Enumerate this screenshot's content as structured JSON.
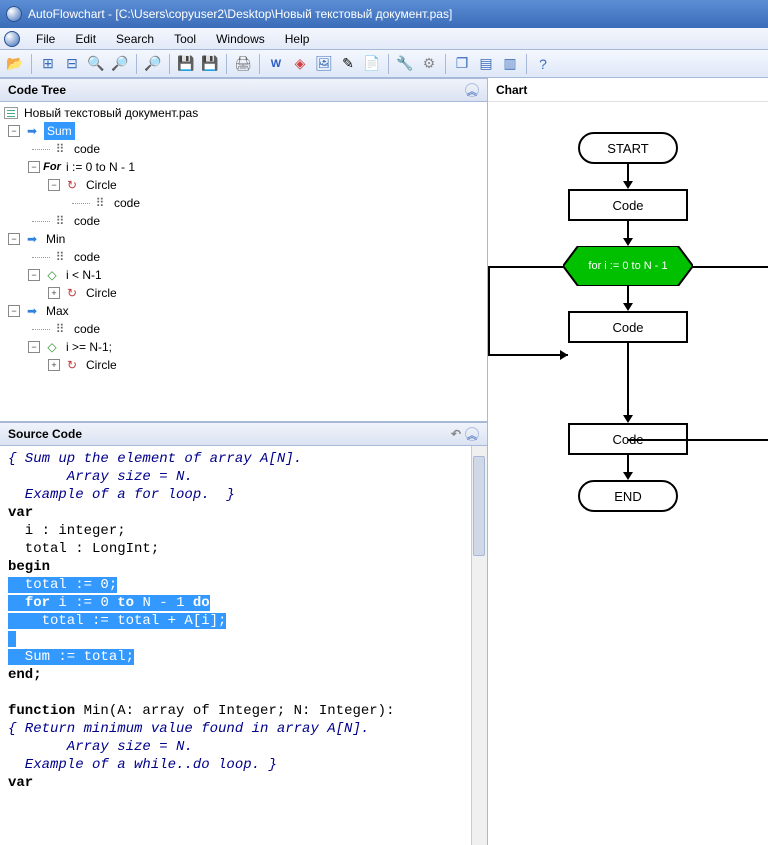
{
  "titlebar": {
    "text": "AutoFlowchart - [C:\\Users\\copyuser2\\Desktop\\Новый текстовый документ.pas]"
  },
  "menu": {
    "items": [
      "File",
      "Edit",
      "Search",
      "Tool",
      "Windows",
      "Help"
    ]
  },
  "panels": {
    "codetree": "Code Tree",
    "sourcecode": "Source Code",
    "chart": "Chart"
  },
  "tree": {
    "rootFile": "Новый текстовый документ.pas",
    "nodes": {
      "sum": "Sum",
      "code": "code",
      "forLoop": "i := 0 to N - 1",
      "forPrefix": "For",
      "circle": "Circle",
      "min": "Min",
      "iLtN": "i < N-1",
      "max": "Max",
      "iGeN": "i >= N-1;"
    }
  },
  "source": {
    "lines": [
      {
        "cls": "comment",
        "text": "{ Sum up the element of array A[N]."
      },
      {
        "cls": "comment",
        "text": "       Array size = N."
      },
      {
        "cls": "comment",
        "text": "  Example of a for loop.  }"
      },
      {
        "cls": "keyword",
        "text": "var"
      },
      {
        "cls": "plain",
        "text": "  i : integer;"
      },
      {
        "cls": "plain",
        "text": "  total : LongInt;"
      },
      {
        "cls": "keyword",
        "text": "begin"
      },
      {
        "cls": "highlight",
        "text": "  total := 0;"
      },
      {
        "cls": "highlight",
        "text": "  for i := 0 to N - 1 do"
      },
      {
        "cls": "highlight",
        "text": "    total := total + A[i];"
      },
      {
        "cls": "highlight",
        "text": " "
      },
      {
        "cls": "highlight",
        "text": "  Sum := total;"
      },
      {
        "cls": "keyword",
        "text": "end;"
      },
      {
        "cls": "plain",
        "text": " "
      },
      {
        "cls": "plain-mixed",
        "prefix_kw": "function",
        "rest": " Min(A: array of Integer; N: Integer):"
      },
      {
        "cls": "comment",
        "text": "{ Return minimum value found in array A[N]."
      },
      {
        "cls": "comment",
        "text": "       Array size = N."
      },
      {
        "cls": "comment",
        "text": "  Example of a while..do loop. }"
      },
      {
        "cls": "keyword",
        "text": "var"
      }
    ]
  },
  "flowchart": {
    "start": "START",
    "code": "Code",
    "loop": "for i := 0 to N - 1",
    "end": "END"
  }
}
